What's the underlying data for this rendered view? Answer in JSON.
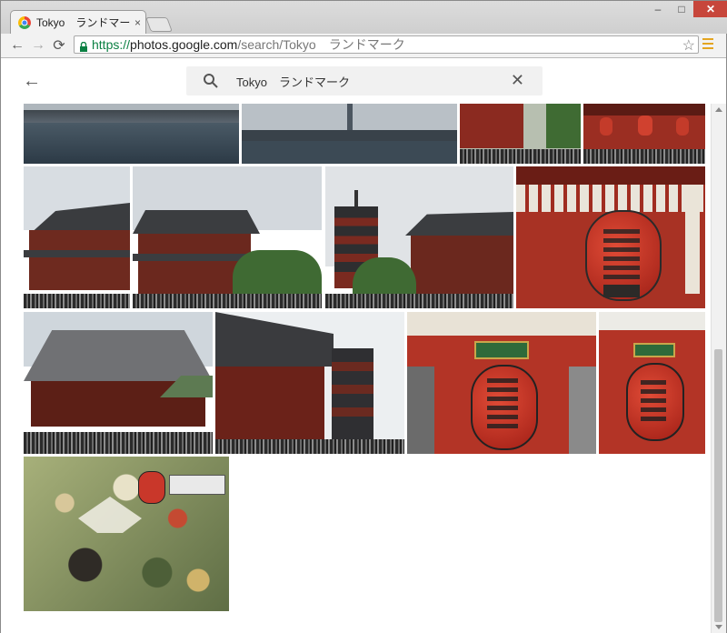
{
  "browser": {
    "tab_title": "Tokyo　ランドマーク - Goog",
    "tab_close": "×",
    "url_scheme": "https://",
    "url_host": "photos.google.com",
    "url_path": "/search/Tokyo　ランドマーク",
    "window_minimize": "–",
    "window_maximize": "□",
    "window_close": "✕",
    "back_glyph": "←",
    "forward_glyph": "→",
    "reload_glyph": "⟳",
    "star_glyph": "☆"
  },
  "app": {
    "back_glyph": "←",
    "search_query": "Tokyo　ランドマーク",
    "clear_glyph": "✕"
  },
  "icons": [
    "chrome-favicon",
    "lock-icon",
    "bookmark-star-icon",
    "chrome-menu-icon",
    "back-arrow-icon",
    "search-icon",
    "clear-icon"
  ],
  "colors": {
    "https_green": "#0b8043",
    "menu_orange": "#e4a521",
    "close_red": "#c7463b"
  },
  "photos": [
    {
      "name": "photo-river-bridge"
    },
    {
      "name": "photo-skytree-river"
    },
    {
      "name": "photo-temple-gate-crowd"
    },
    {
      "name": "photo-temple-gate-lanterns"
    },
    {
      "name": "photo-hozomon-left"
    },
    {
      "name": "photo-hozomon-center"
    },
    {
      "name": "photo-pagoda-hozomon"
    },
    {
      "name": "photo-kaminarimon-lantern-closeup"
    },
    {
      "name": "photo-main-hall"
    },
    {
      "name": "photo-temple-pagoda-side"
    },
    {
      "name": "photo-kaminarimon-lantern"
    },
    {
      "name": "photo-kaminarimon-lantern-small"
    },
    {
      "name": "photo-mural"
    }
  ]
}
